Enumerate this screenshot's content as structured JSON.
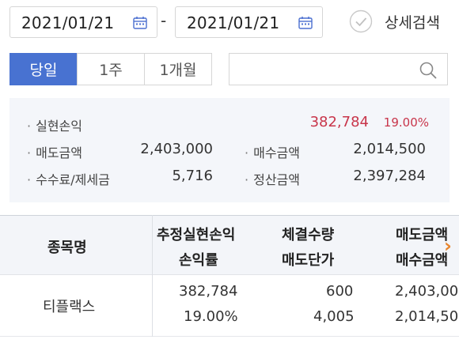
{
  "date_range": {
    "start": "2021/01/21",
    "end": "2021/01/21",
    "separator": "-"
  },
  "detail_search_label": "상세검색",
  "period_tabs": [
    {
      "label": "당일",
      "active": true
    },
    {
      "label": "1주",
      "active": false
    },
    {
      "label": "1개월",
      "active": false
    }
  ],
  "search": {
    "value": "",
    "placeholder": ""
  },
  "summary": {
    "realized_pl": {
      "label": "실현손익",
      "value": "382,784",
      "rate": "19.00%"
    },
    "sell_amount": {
      "label": "매도금액",
      "value": "2,403,000"
    },
    "buy_amount": {
      "label": "매수금액",
      "value": "2,014,500"
    },
    "fees_taxes": {
      "label": "수수료/제세금",
      "value": "5,716"
    },
    "settlement_amount": {
      "label": "정산금액",
      "value": "2,397,284"
    }
  },
  "table": {
    "headers": {
      "col1": "종목명",
      "col2_line1": "추정실현손익",
      "col2_line2": "손익률",
      "col3_line1": "체결수량",
      "col3_line2": "매도단가",
      "col4_line1": "매도금액",
      "col4_line2": "매수금액"
    },
    "rows": [
      {
        "name": "티플랙스",
        "est_realized_pl": "382,784",
        "pl_rate": "19.00%",
        "qty": "600",
        "sell_price": "4,005",
        "sell_amount": "2,403,000",
        "buy_amount": "2,014,500"
      }
    ]
  },
  "colors": {
    "accent": "#4872d1",
    "profit": "#c8354a",
    "scroll_hint": "#e8852d"
  }
}
